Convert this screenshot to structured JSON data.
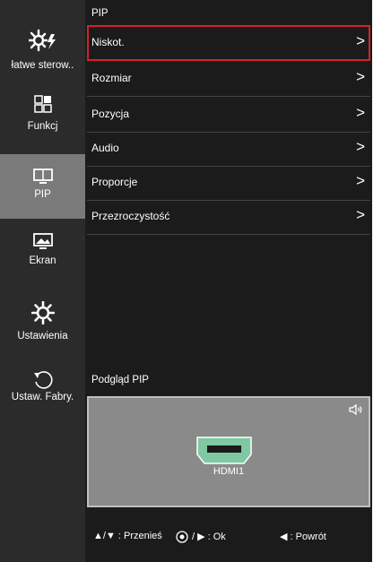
{
  "header": {
    "title": "PIP"
  },
  "sidebar": {
    "items": [
      {
        "label": "łatwe sterow..",
        "icon": "quick-settings-icon"
      },
      {
        "label": "Funkcj",
        "icon": "function-icon"
      },
      {
        "label": "PIP",
        "icon": "pip-icon",
        "active": true
      },
      {
        "label": "Ekran",
        "icon": "screen-icon"
      },
      {
        "label": "Ustawienia",
        "icon": "settings-gear-icon"
      },
      {
        "label": "Ustaw. Fabry.",
        "icon": "reset-icon"
      }
    ]
  },
  "menu": {
    "items": [
      {
        "label": "Niskot.",
        "arrow": ">",
        "selected": true
      },
      {
        "label": "Rozmiar",
        "arrow": ">"
      },
      {
        "label": "Pozycja",
        "arrow": ">"
      },
      {
        "label": "Audio",
        "arrow": ">"
      },
      {
        "label": "Proporcje",
        "arrow": ">"
      },
      {
        "label": "Przezroczystość",
        "arrow": ">"
      }
    ]
  },
  "preview": {
    "title": "Podgląd PIP",
    "source_label": "HDMI1",
    "speaker_icon": "speaker-icon"
  },
  "footer": {
    "move": "▲/▼ : Przenieś",
    "ok": "/ ▶ : Ok",
    "back": "◀ : Powrót"
  },
  "colors": {
    "highlight": "#d2232a",
    "hdmi_green": "#7fc8a3",
    "active_tab": "#7a7a7a"
  }
}
